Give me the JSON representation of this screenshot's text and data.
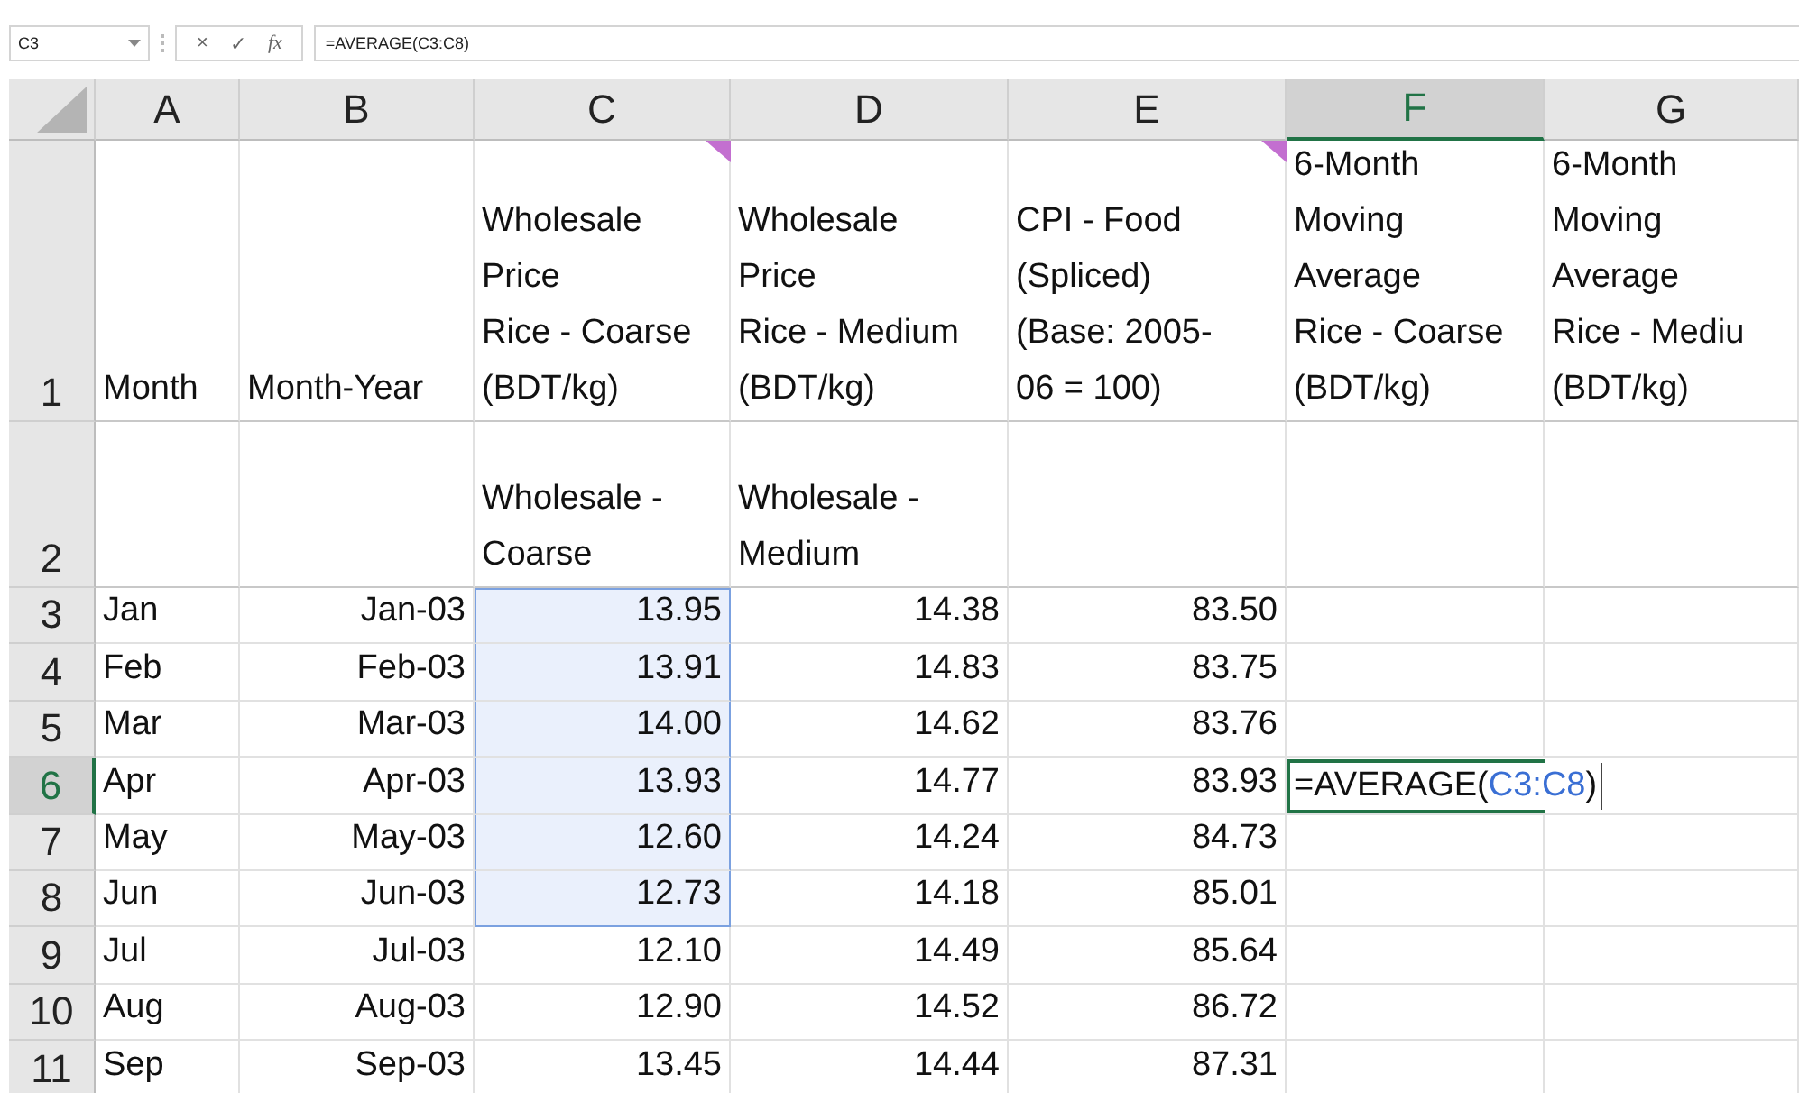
{
  "name_box": "C3",
  "formula_buttons": [
    "×",
    "✓",
    "fx"
  ],
  "formula": "=AVERAGE(C3:C8)",
  "columns": [
    {
      "label": "A",
      "selected": false
    },
    {
      "label": "B",
      "selected": false
    },
    {
      "label": "C",
      "selected": false
    },
    {
      "label": "D",
      "selected": false
    },
    {
      "label": "E",
      "selected": false
    },
    {
      "label": "F",
      "selected": true
    },
    {
      "label": "G",
      "selected": false
    }
  ],
  "rows": [
    {
      "label": "1",
      "kind": "header",
      "selected": false,
      "cells": {
        "A": "Month",
        "B": "Month-Year",
        "C": {
          "text": "Wholesale\nPrice\nRice - Coarse\n(BDT/kg)",
          "comment": true
        },
        "D": "Wholesale\nPrice\nRice - Medium\n(BDT/kg)",
        "E": {
          "text": "CPI - Food\n(Spliced)\n(Base: 2005-\n06 = 100)",
          "comment": true
        },
        "F": "6-Month\nMoving\nAverage\nRice - Coarse\n(BDT/kg)",
        "G": "6-Month\nMoving\nAverage\nRice - Mediu\n(BDT/kg)"
      }
    },
    {
      "label": "2",
      "kind": "header",
      "selected": false,
      "cells": {
        "C": "Wholesale -\nCoarse",
        "D": "Wholesale -\nMedium"
      }
    },
    {
      "label": "3",
      "kind": "data",
      "selected": false,
      "in_range": true,
      "cells": {
        "A": "Jan",
        "B": "Jan-03",
        "C": "13.95",
        "D": "14.38",
        "E": "83.50"
      }
    },
    {
      "label": "4",
      "kind": "data",
      "selected": false,
      "in_range": true,
      "cells": {
        "A": "Feb",
        "B": "Feb-03",
        "C": "13.91",
        "D": "14.83",
        "E": "83.75"
      }
    },
    {
      "label": "5",
      "kind": "data",
      "selected": false,
      "in_range": true,
      "cells": {
        "A": "Mar",
        "B": "Mar-03",
        "C": "14.00",
        "D": "14.62",
        "E": "83.76"
      }
    },
    {
      "label": "6",
      "kind": "data",
      "selected": true,
      "in_range": true,
      "cells": {
        "A": "Apr",
        "B": "Apr-03",
        "C": "13.93",
        "D": "14.77",
        "E": "83.93",
        "F": {
          "kind": "formula_edit",
          "prefix": "=AVERAGE(",
          "reference": "C3:C8",
          "suffix": ")"
        }
      }
    },
    {
      "label": "7",
      "kind": "data",
      "selected": false,
      "in_range": true,
      "cells": {
        "A": "May",
        "B": "May-03",
        "C": "12.60",
        "D": "14.24",
        "E": "84.73"
      }
    },
    {
      "label": "8",
      "kind": "data",
      "selected": false,
      "in_range": true,
      "cells": {
        "A": "Jun",
        "B": "Jun-03",
        "C": "12.73",
        "D": "14.18",
        "E": "85.01"
      }
    },
    {
      "label": "9",
      "kind": "data",
      "selected": false,
      "in_range": false,
      "cells": {
        "A": "Jul",
        "B": "Jul-03",
        "C": "12.10",
        "D": "14.49",
        "E": "85.64"
      }
    },
    {
      "label": "10",
      "kind": "data",
      "selected": false,
      "in_range": false,
      "cells": {
        "A": "Aug",
        "B": "Aug-03",
        "C": "12.90",
        "D": "14.52",
        "E": "86.72"
      }
    },
    {
      "label": "11",
      "kind": "data",
      "selected": false,
      "in_range": false,
      "cells": {
        "A": "Sep",
        "B": "Sep-03",
        "C": "13.45",
        "D": "14.44",
        "E": "87.31"
      }
    }
  ]
}
